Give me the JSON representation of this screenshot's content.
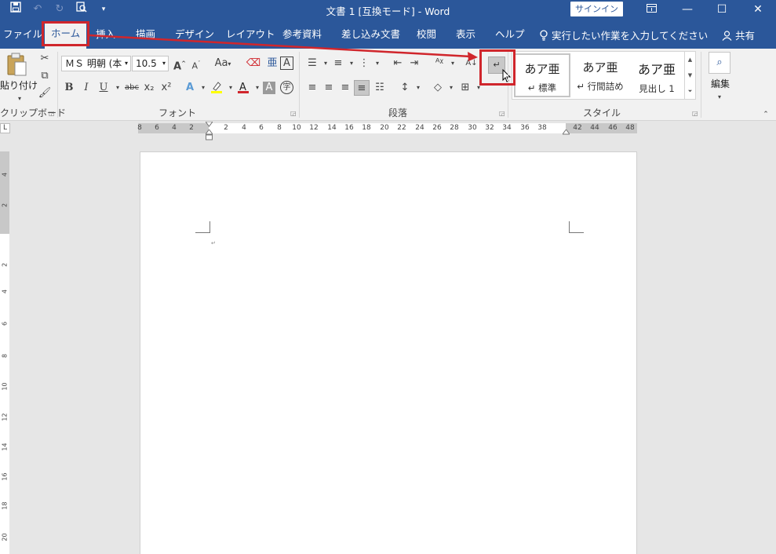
{
  "titlebar": {
    "title": "文書 1 [互換モード] - Word",
    "signin": "サインイン",
    "qat": {
      "save_icon": "save-icon",
      "undo_icon": "undo-icon",
      "redo_icon": "redo-icon",
      "preview_icon": "print-preview-icon",
      "customize_icon": "customize-qat-icon"
    }
  },
  "tabs": [
    "ファイル",
    "ホーム",
    "挿入",
    "描画",
    "デザイン",
    "レイアウト",
    "参考資料",
    "差し込み文書",
    "校閲",
    "表示",
    "ヘルプ"
  ],
  "active_tab": "ホーム",
  "tellme": "実行したい作業を入力してください",
  "share": "共有",
  "clipboard": {
    "paste": "貼り付け",
    "label": "クリップボード"
  },
  "font": {
    "name": "ＭＳ 明朝 (本",
    "size": "10.5",
    "label": "フォント",
    "bold": "B",
    "italic": "I",
    "underline": "U",
    "strike": "abc",
    "sub": "x₂",
    "sup": "x²",
    "grow": "A",
    "shrink": "A",
    "case": "Aa",
    "clear": "A",
    "boxed": "A"
  },
  "paragraph": {
    "label": "段落"
  },
  "styles": {
    "label": "スタイル",
    "items": [
      {
        "sample": "あア亜",
        "name": "標準"
      },
      {
        "sample": "あア亜",
        "name": "行間詰め"
      },
      {
        "sample": "あア亜",
        "name": "見出し 1"
      }
    ]
  },
  "editing": {
    "label": "編集"
  },
  "ruler": {
    "h_numbers": [
      "8",
      "6",
      "4",
      "2",
      "2",
      "4",
      "6",
      "8",
      "10",
      "12",
      "14",
      "16",
      "18",
      "20",
      "22",
      "24",
      "26",
      "28",
      "30",
      "32",
      "34",
      "36",
      "38",
      "42",
      "44",
      "46",
      "48"
    ],
    "v_numbers": [
      "4",
      "2",
      "2",
      "4",
      "6",
      "8",
      "10",
      "12",
      "14",
      "16",
      "18",
      "20"
    ],
    "corner": "L"
  },
  "colors": {
    "accent": "#2b579a",
    "highlight": "#d0262c"
  }
}
